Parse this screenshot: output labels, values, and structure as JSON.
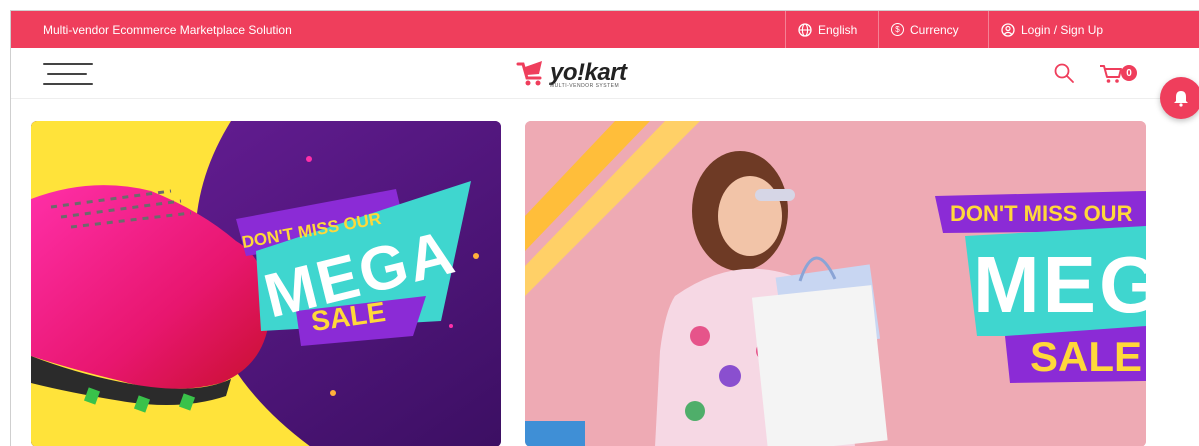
{
  "topbar": {
    "tagline": "Multi-vendor Ecommerce Marketplace Solution",
    "language": "English",
    "currency": "Currency",
    "login": "Login / Sign Up"
  },
  "header": {
    "logo_text": "yo!kart",
    "logo_subtext": "MULTI-VENDOR SYSTEM",
    "cart_count": "0"
  },
  "banners": [
    {
      "line1": "DON'T MISS OUR",
      "line2": "MEGA",
      "line3": "SALE"
    },
    {
      "line1": "DON'T MISS OUR",
      "line2": "MEG",
      "line3": "SALE"
    }
  ],
  "colors": {
    "brand": "#ef3e5c",
    "banner1_bg": "#5b1a86",
    "banner2_bg": "#eeaab4",
    "teal": "#3fd6cf",
    "sale_yellow": "#ffd83a"
  },
  "icons": [
    "globe-icon",
    "currency-icon",
    "user-icon",
    "menu-icon",
    "search-icon",
    "cart-icon",
    "bell-icon"
  ]
}
